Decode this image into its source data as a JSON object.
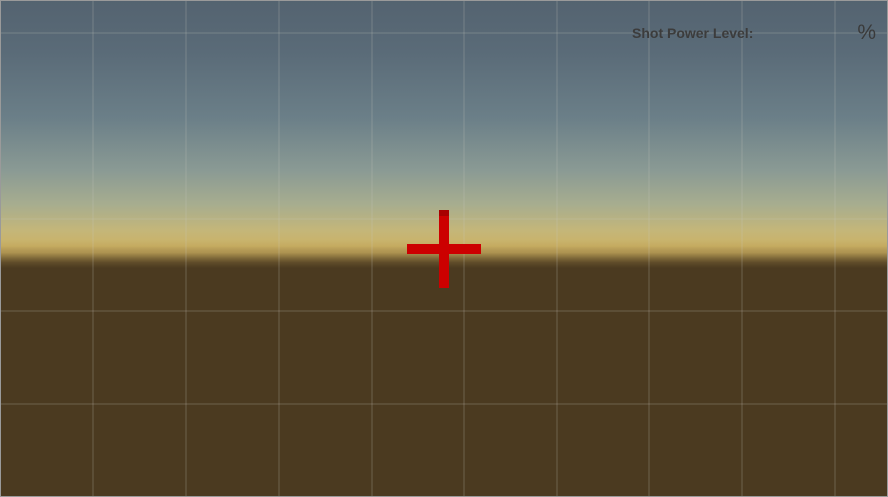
{
  "hud": {
    "power_label": "Shot Power Level:",
    "power_value": "",
    "power_unit": "%"
  },
  "crosshair": {
    "color": "#cc0000",
    "icon": "crosshair-icon"
  },
  "scene": {
    "sky_color": "#546370",
    "horizon_color": "#cbb266",
    "ground_color": "#4b3a20",
    "grid_color": "#c8c8be"
  }
}
